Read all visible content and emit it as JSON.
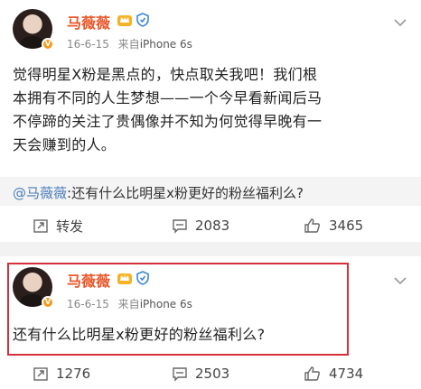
{
  "post1": {
    "author": "马薇薇",
    "date": "16-6-15",
    "source_prefix": "来自",
    "source": "iPhone 6s",
    "body_lines": [
      "觉得明星X粉是黑点的，快点取关我吧！我们根",
      "本拥有不同的人生梦想——一个今早看新闻后马",
      "不停蹄的关注了贵偶像并不知为何觉得早晚有一",
      "天会赚到的人。"
    ],
    "quote_mention": "@马薇薇",
    "quote_text": ":还有什么比明星x粉更好的粉丝福利么?",
    "actions": {
      "repost_label": "转发",
      "comment_count": "2083",
      "like_count": "3465"
    }
  },
  "post2": {
    "author": "马薇薇",
    "date": "16-6-15",
    "source_prefix": "来自",
    "source": "iPhone 6s",
    "body": "还有什么比明星x粉更好的粉丝福利么?",
    "actions": {
      "repost_count": "1276",
      "comment_count": "2503",
      "like_count": "4734"
    }
  },
  "colors": {
    "name": "#e8572a",
    "mention": "#4a7db8",
    "highlight_border": "#d42f3a",
    "verified_badge": "#f39b1c"
  },
  "icons": [
    "verified-v-icon",
    "crown-badge-icon",
    "shield-badge-icon",
    "chevron-down-icon",
    "repost-icon",
    "comment-icon",
    "like-icon"
  ]
}
